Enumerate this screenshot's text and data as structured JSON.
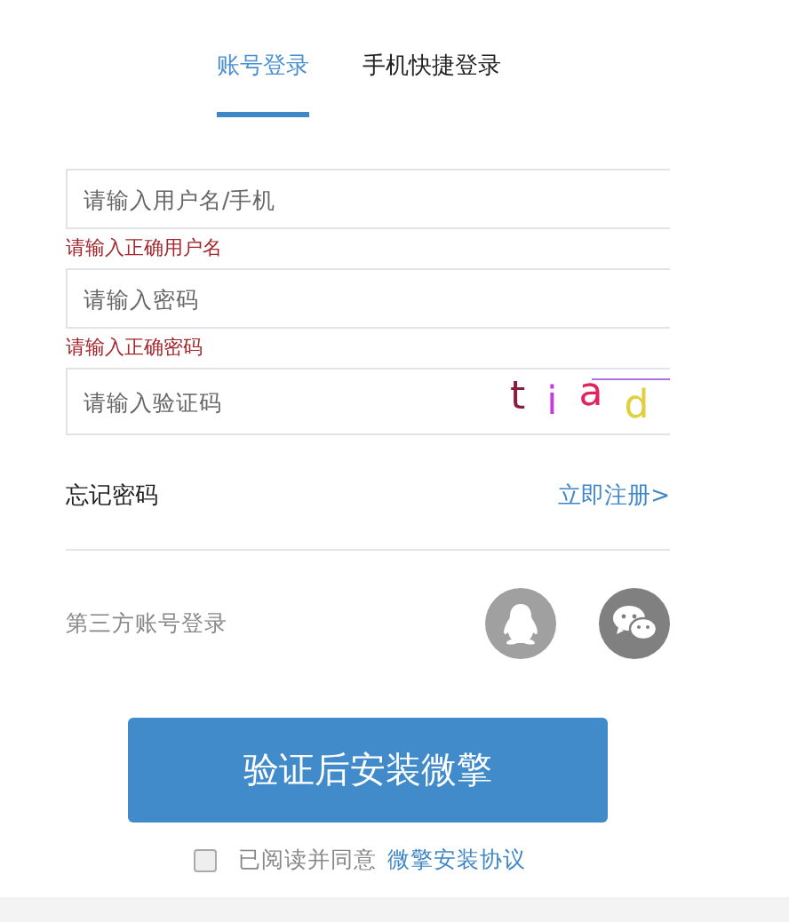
{
  "tabs": [
    {
      "label": "账号登录",
      "selected": true
    },
    {
      "label": "手机快捷登录",
      "selected": false
    }
  ],
  "fields": [
    {
      "placeholder": "请输入用户名/手机",
      "error": "请输入正确用户名"
    },
    {
      "placeholder": "请输入密码",
      "error": "请输入正确密码"
    },
    {
      "placeholder": "请输入验证码",
      "captcha": [
        "t",
        "i",
        "a",
        "d"
      ]
    }
  ],
  "forgot_password": "忘记密码",
  "register_link": "立即注册>",
  "third_party": {
    "label": "第三方账号登录"
  },
  "submit_button": "验证后安装微擎",
  "agreement": {
    "checked": false,
    "text": "已阅读并同意",
    "link": "微擎安装协议"
  }
}
